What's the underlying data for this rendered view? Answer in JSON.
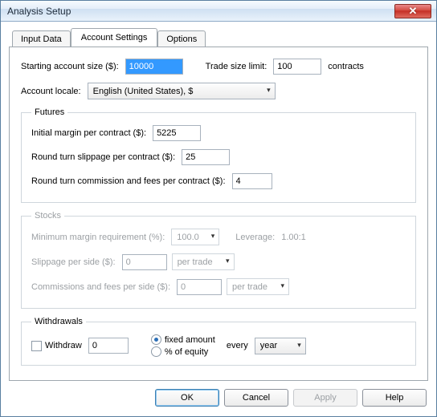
{
  "window": {
    "title": "Analysis Setup"
  },
  "tabs": {
    "input_data": "Input Data",
    "account_settings": "Account Settings",
    "options": "Options"
  },
  "top": {
    "starting_label": "Starting account size ($):",
    "starting_value": "10000",
    "trade_limit_label": "Trade size limit:",
    "trade_limit_value": "100",
    "trade_limit_units": "contracts",
    "locale_label": "Account locale:",
    "locale_value": "English (United States), $"
  },
  "futures": {
    "legend": "Futures",
    "initial_margin_label": "Initial margin per contract ($):",
    "initial_margin_value": "5225",
    "slippage_label": "Round turn slippage per contract ($):",
    "slippage_value": "25",
    "commission_label": "Round turn commission and fees per contract ($):",
    "commission_value": "4"
  },
  "stocks": {
    "legend": "Stocks",
    "min_margin_label": "Minimum margin requirement (%):",
    "min_margin_value": "100.0",
    "leverage_label": "Leverage:",
    "leverage_value": "1.00:1",
    "slippage_label": "Slippage per side ($):",
    "slippage_value": "0",
    "slippage_mode": "per trade",
    "commission_label": "Commissions and fees per side ($):",
    "commission_value": "0",
    "commission_mode": "per trade"
  },
  "withdrawals": {
    "legend": "Withdrawals",
    "withdraw_label": "Withdraw",
    "withdraw_value": "0",
    "fixed_label": "fixed amount",
    "pct_label": "% of equity",
    "every_label": "every",
    "period_value": "year"
  },
  "buttons": {
    "ok": "OK",
    "cancel": "Cancel",
    "apply": "Apply",
    "help": "Help"
  }
}
